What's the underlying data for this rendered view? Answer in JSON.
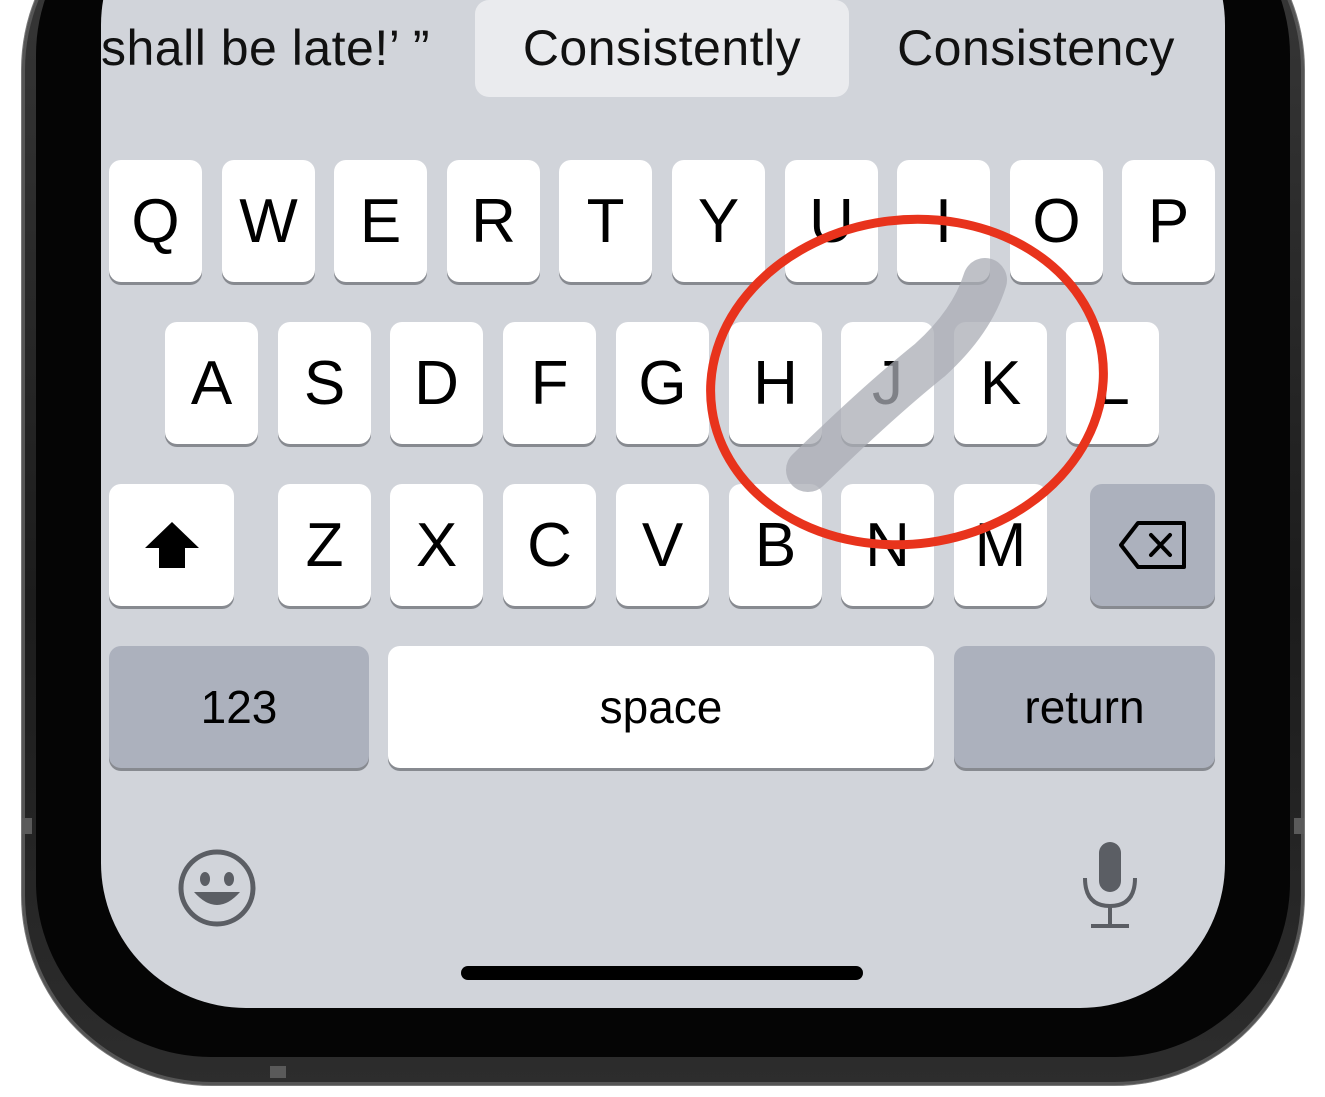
{
  "suggestions": {
    "left": "shall be late!’ ”",
    "middle": "Consistently",
    "right": "Consistency"
  },
  "keyboard": {
    "row1": [
      "Q",
      "W",
      "E",
      "R",
      "T",
      "Y",
      "U",
      "I",
      "O",
      "P"
    ],
    "row2": [
      "A",
      "S",
      "D",
      "F",
      "G",
      "H",
      "J",
      "K",
      "L"
    ],
    "row3": [
      "Z",
      "X",
      "C",
      "V",
      "B",
      "N",
      "M"
    ],
    "numbers_label": "123",
    "space_label": "space",
    "return_label": "return"
  },
  "icons": {
    "shift": "shift-arrow-icon",
    "delete": "delete-backspace-icon",
    "emoji": "emoji-smiley-icon",
    "mic": "microphone-icon"
  },
  "colors": {
    "keyboard_bg": "#d1d4da",
    "key": "#ffffff",
    "function_key": "#acb1bd",
    "annotation_circle": "#e8331c",
    "swipe_trail": "#a9acb4"
  }
}
